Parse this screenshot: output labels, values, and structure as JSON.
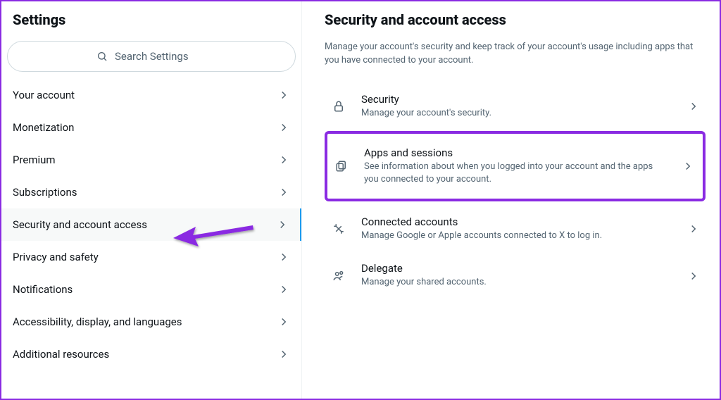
{
  "sidebar": {
    "title": "Settings",
    "search_placeholder": "Search Settings",
    "items": [
      {
        "label": "Your account"
      },
      {
        "label": "Monetization"
      },
      {
        "label": "Premium"
      },
      {
        "label": "Subscriptions"
      },
      {
        "label": "Security and account access"
      },
      {
        "label": "Privacy and safety"
      },
      {
        "label": "Notifications"
      },
      {
        "label": "Accessibility, display, and languages"
      },
      {
        "label": "Additional resources"
      }
    ],
    "active_index": 4
  },
  "main": {
    "heading": "Security and account access",
    "intro": "Manage your account's security and keep track of your account's usage including apps that you have connected to your account.",
    "options": [
      {
        "title": "Security",
        "desc": "Manage your account's security."
      },
      {
        "title": "Apps and sessions",
        "desc": "See information about when you logged into your account and the apps you connected to your account."
      },
      {
        "title": "Connected accounts",
        "desc": "Manage Google or Apple accounts connected to X to log in."
      },
      {
        "title": "Delegate",
        "desc": "Manage your shared accounts."
      }
    ],
    "highlight_index": 1
  },
  "colors": {
    "highlight": "#8a2be2",
    "link": "#1d9bf0"
  }
}
